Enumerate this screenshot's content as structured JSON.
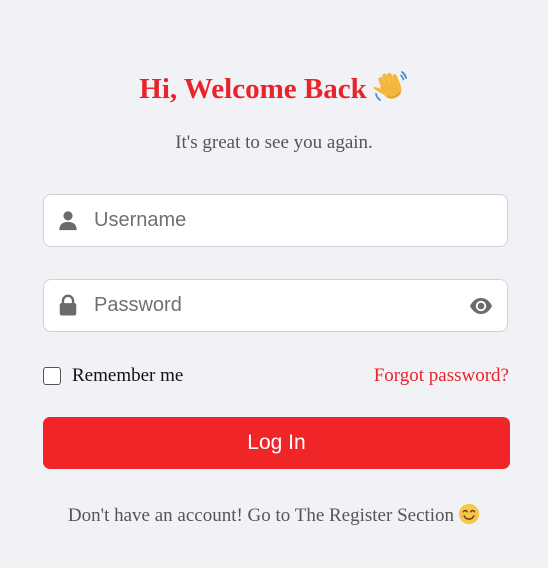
{
  "header": {
    "title": "Hi, Welcome Back",
    "title_icon": "waving-hand-icon",
    "subtitle": "It's great to see you again."
  },
  "form": {
    "username": {
      "placeholder": "Username",
      "value": "",
      "icon": "user-icon"
    },
    "password": {
      "placeholder": "Password",
      "value": "",
      "icon": "lock-icon",
      "toggle_icon": "eye-icon"
    },
    "remember_label": "Remember me",
    "remember_checked": false,
    "forgot_label": "Forgot password?",
    "login_label": "Log In"
  },
  "footer": {
    "text": "Don't have an account! Go to The Register Section",
    "icon": "smiling-face-icon"
  },
  "colors": {
    "accent": "#e8242a",
    "button": "#f02527",
    "background": "#f1f2f6",
    "muted_text": "#555555",
    "icon_gray": "#6b6b6b"
  }
}
